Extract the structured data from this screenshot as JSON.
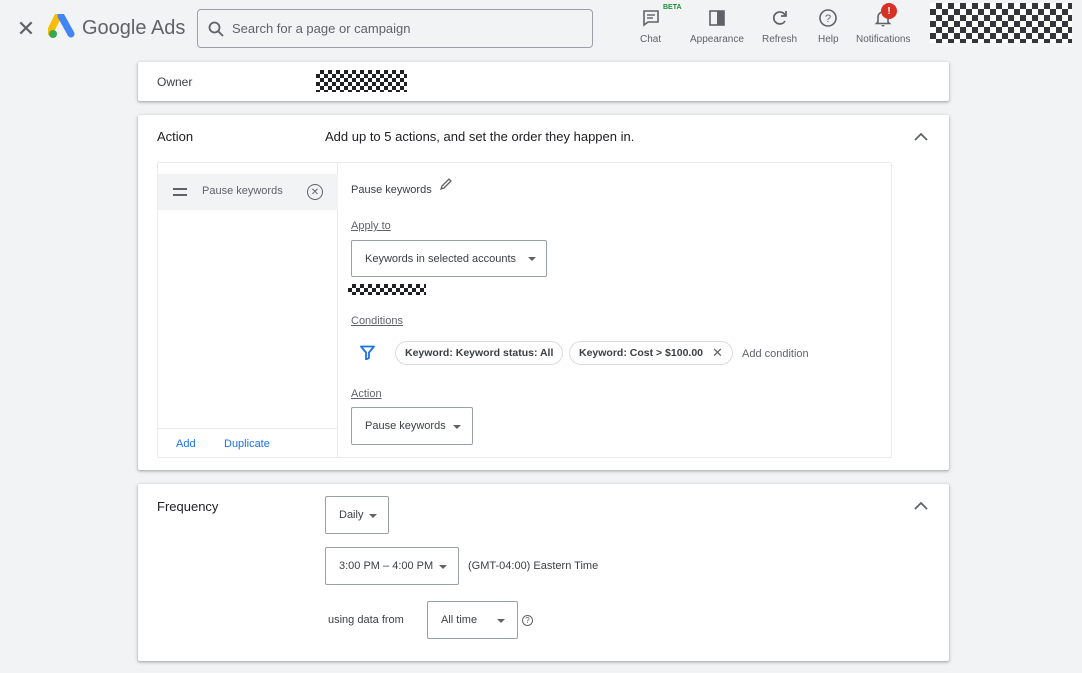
{
  "header": {
    "brand": "Google Ads",
    "search_placeholder": "Search for a page or campaign",
    "tools": [
      {
        "label": "Chat",
        "badge": "BETA",
        "icon": "chat-icon"
      },
      {
        "label": "Appearance",
        "icon": "appearance-icon"
      },
      {
        "label": "Refresh",
        "icon": "refresh-icon"
      },
      {
        "label": "Help",
        "icon": "help-icon"
      },
      {
        "label": "Notifications",
        "badge": "!",
        "icon": "bell-icon"
      }
    ]
  },
  "owner": {
    "label": "Owner"
  },
  "action": {
    "title": "Action",
    "description": "Add up to 5 actions, and set the order they happen in.",
    "items": [
      {
        "label": "Pause keywords"
      }
    ],
    "add_label": "Add",
    "duplicate_label": "Duplicate",
    "detail": {
      "title": "Pause keywords",
      "apply_to_label": "Apply to",
      "apply_to_value": "Keywords in selected accounts",
      "conditions_label": "Conditions",
      "conditions": [
        {
          "label": "Keyword: Keyword status: All"
        },
        {
          "label": "Keyword: Cost > $100.00"
        }
      ],
      "add_condition": "Add condition",
      "action_label": "Action",
      "action_value": "Pause keywords"
    }
  },
  "frequency": {
    "title": "Frequency",
    "period": "Daily",
    "time_range": "3:00 PM – 4:00 PM",
    "timezone": "(GMT-04:00) Eastern Time",
    "using_data_label": "using data from",
    "data_range": "All time"
  },
  "colors": {
    "accent": "#1a73e8",
    "background": "#f1f3f4",
    "alert": "#d93025"
  }
}
